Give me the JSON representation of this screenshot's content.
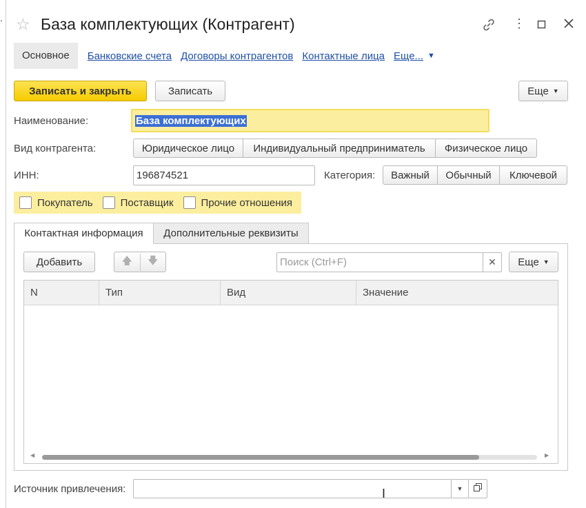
{
  "window": {
    "title": "База комплектующих (Контрагент)",
    "icons": [
      "star-icon",
      "link-icon",
      "more-vertical-icon",
      "maximize-icon",
      "close-icon"
    ]
  },
  "nav": {
    "active": "Основное",
    "links": [
      "Банковские счета",
      "Договоры контрагентов",
      "Контактные лица",
      "Еще..."
    ]
  },
  "toolbar": {
    "save_close": "Записать и закрыть",
    "save": "Записать",
    "more": "Еще"
  },
  "form": {
    "name_label": "Наименование:",
    "name_value": "База комплектующих",
    "type_label": "Вид контрагента:",
    "type_options": [
      "Юридическое лицо",
      "Индивидуальный предприниматель",
      "Физическое лицо"
    ],
    "inn_label": "ИНН:",
    "inn_value": "196874521",
    "category_label": "Категория:",
    "category_options": [
      "Важный",
      "Обычный",
      "Ключевой"
    ],
    "checkboxes": [
      "Покупатель",
      "Поставщик",
      "Прочие отношения"
    ],
    "source_label": "Источник привлечения:",
    "source_value": ""
  },
  "page_tabs": [
    "Контактная информация",
    "Дополнительные реквизиты"
  ],
  "contacts": {
    "add_button": "Добавить",
    "search_placeholder": "Поиск (Ctrl+F)",
    "more": "Еще",
    "columns": [
      "N",
      "Тип",
      "Вид",
      "Значение"
    ],
    "rows": []
  },
  "colors": {
    "accent_yellow": "#f5cb00",
    "highlight": "#fbee9e",
    "link": "#1f4fa6",
    "selection": "#3b6fd4"
  }
}
